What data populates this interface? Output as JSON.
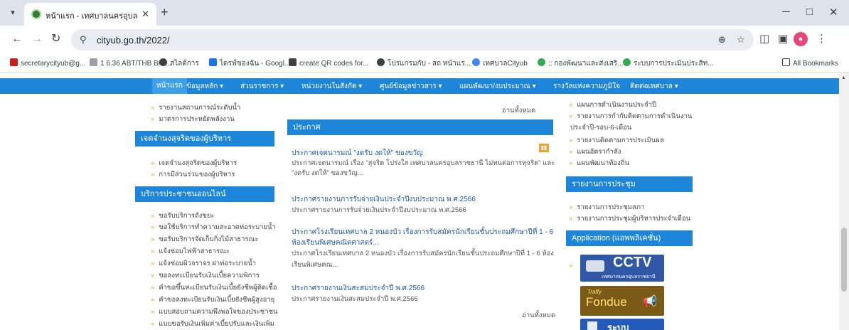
{
  "browser": {
    "tab_title": "หน้าแรก - เทศบาลนครอุบลราชธานี",
    "url": "cityub.go.th/2022/",
    "bookmarks": [
      {
        "label": "secretarycityub@g...",
        "color": "#c5221f"
      },
      {
        "label": "1 6.36 ABT/THB Bitk...",
        "color": "#9aa0a6"
      },
      {
        "label": "สไลด์การ",
        "color": "#3c4043"
      },
      {
        "label": "ไดรฟ์ของฉัน - Googl...",
        "color": "#1a73e8"
      },
      {
        "label": "create QR codes for...",
        "color": "#3c4043"
      },
      {
        "label": "โปรแกรมกับ - สถ หน้าแร...",
        "color": "#3c4043"
      },
      {
        "label": "เทศบาลCityub",
        "color": "#4285f4"
      },
      {
        "label": ":: กองพัฒนาและส่งเสริ...",
        "color": "#34a853"
      },
      {
        "label": "ระบบการประเมินประสิท...",
        "color": "#34a853"
      }
    ],
    "all_bookmarks": "All Bookmarks"
  },
  "nav": {
    "items": [
      "หน้าแรก",
      "ข้อมูลหลัก ▾",
      "ส่วนราชการ ▾",
      "หน่วยงานในสังกัด ▾",
      "ศูนย์ข้อมูลข่าวสาร ▾",
      "แผนพัฒนา/งบประมาณ ▾",
      "รางวัลแห่งความภูมิใจ",
      "ติดต่อเทศบาล ▾"
    ]
  },
  "left": {
    "top_links": [
      "รายงานสถานการณ์ระดับน้ำ",
      "มาตรการประหยัดพลังงาน"
    ],
    "integrity_header": "เจตจำนงสุจริตของผู้บริหาร",
    "integrity_links": [
      "เจตจำนงสุจริตของผู้บริหาร",
      "การมีส่วนร่วมของผู้บริหาร"
    ],
    "services_header": "บริการประชาชนออนไลน์",
    "services_links": [
      "ขอรับบริการถังขยะ",
      "ขอใช้บริการทำความสะอาดท่อระบายน้ำ",
      "ขอรับบริการจัดเก็บกิ่งไม้สาธารณะ",
      "แจ้งซ่อมไฟฟ้าสาธารณะ",
      "แจ้งซ่อมผิวจราจร ฝาท่อระบายน้ำ",
      "ขอลงทะเบียนรับเงินเบี้ยความพิการ",
      "คำขอขึ้นทะเบียนรับเงินเบี้ยยังชีพผู้ติดเชื้อ",
      "คำขอลงทะเบียนรับเงินเบี้ยยังชีพผู้สูงอายุ",
      "แบบสอบถามความพึงพอใจของประชาชน",
      "แบบขอรับเงินเพิ่มค่าเบี้ยปรับและเงินเพิ่ม"
    ]
  },
  "center": {
    "read_all": "อ่านทั้งหมด",
    "header": "ประกาศ",
    "items": [
      {
        "title": "ประกาศเจตนารมณ์ \"งดรับ งดให้\" ของขวัญ",
        "desc1": "ประกาศเจตนารมณ์ เรื่อง \"สุจริต โปร่งใส เทศบาลนครอุบลราชธานี ไม่ทนต่อการทุจริต\" และ",
        "desc2": "\"งดรับ งดให้\" ของขวัญ..."
      },
      {
        "title": "ประกาศรายงานการรับจ่ายเงินประจำปีงบประมาณ พ.ศ.2566",
        "desc1": "ประกาศรายงานการรับจ่ายเงินประจำปีงบประมาณ พ.ศ.2566"
      },
      {
        "title": "ประกาศโรงเรียนเทศบาล 2 หนองบัว เรื่องการรับสมัครนักเรียนชั้นประถมศึกษาปีที่ 1 - 6",
        "title2": "ห้องเรียนพิเศษคณิตศาสตร์...",
        "desc1": "ประกาศโรงเรียนเทศบาล 2 หนองบัว เรื่องการรับสมัครนักเรียนชั้นประถมศึกษาปีที่ 1 - 6 ห้อง",
        "desc2": "เรียนพิเศษคณ..."
      },
      {
        "title": "ประกาศรายงานเงินสะสมประจำปี พ.ศ.2566",
        "desc1": "ประกาศรายงานเงินสะสมประจำปี พ.ศ.2566"
      }
    ],
    "read_all_bottom": "อ่านทั้งหมด"
  },
  "right": {
    "top_links": [
      "แผนการดำเนินงานประจำปี",
      "รายงานการกำกับติดตามการดำเนินงาน"
    ],
    "top_link_cont": "ประจำปี-รอบ-6-เดือน",
    "more_links": [
      "รายงานติดตามการประเมินผล",
      "แผนอัตรากำลัง",
      "แผนพัฒนาท้องถิ่น"
    ],
    "meeting_header": "รายงานการประชุม",
    "meeting_links": [
      "รายงานการประชุมสภา",
      "รายงานการประชุมผู้บริหารประจำเดือน"
    ],
    "app_header": "Application (แอพพลิเคชั่น)",
    "cctv_label": "CCTV",
    "cctv_sub": "เทศบาลนครอุบลราชธานี",
    "fondue_small": "Traffy",
    "fondue_label": "Fondue",
    "system_label": "ระบบ"
  }
}
